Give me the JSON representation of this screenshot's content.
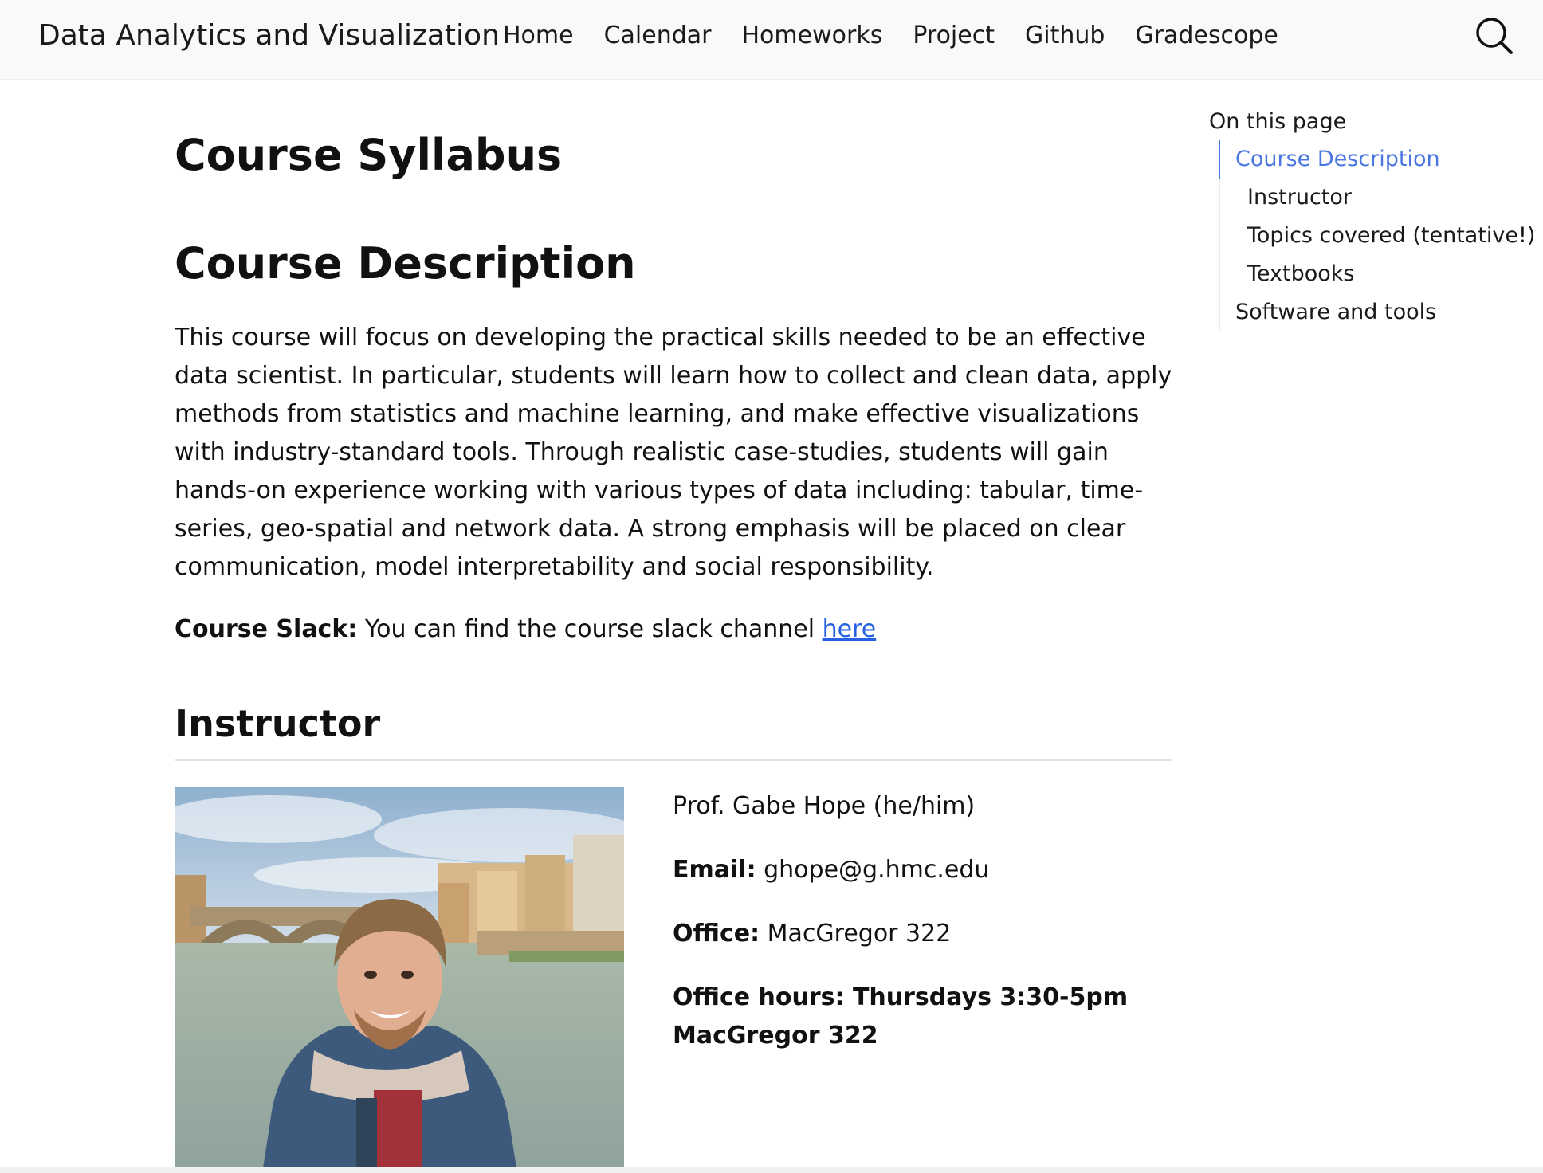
{
  "navbar": {
    "brand": "Data Analytics and Visualization",
    "links": [
      "Home",
      "Calendar",
      "Homeworks",
      "Project",
      "Github",
      "Gradescope"
    ],
    "search_icon": "search-icon"
  },
  "page": {
    "title": "Course Syllabus",
    "course_description": {
      "heading": "Course Description",
      "paragraph": "This course will focus on developing the practical skills needed to be an effective data scientist. In particular, students will learn how to collect and clean data, apply methods from statistics and machine learning, and make effective visualizations with industry-standard tools. Through realistic case-studies, students will gain hands-on experience working with various types of data including: tabular, time-series, geo-spatial and network data. A strong emphasis will be placed on clear communication, model interpretability and social responsibility.",
      "slack_label": "Course Slack:",
      "slack_text": "You can find the course slack channel",
      "slack_link": "here"
    },
    "instructor": {
      "heading": "Instructor",
      "name": "Prof. Gabe Hope (he/him)",
      "email_label": "Email:",
      "email": "ghope@g.hmc.edu",
      "office_label": "Office:",
      "office": "MacGregor 322",
      "hours": "Office hours: Thursdays 3:30-5pm MacGregor 322"
    }
  },
  "toc": {
    "heading": "On this page",
    "items": [
      {
        "label": "Course Description",
        "level": 1,
        "active": true
      },
      {
        "label": "Instructor",
        "level": 2,
        "active": false
      },
      {
        "label": "Topics covered (tentative!)",
        "level": 2,
        "active": false
      },
      {
        "label": "Textbooks",
        "level": 2,
        "active": false
      },
      {
        "label": "Software and tools",
        "level": 1,
        "active": false
      }
    ]
  },
  "colors": {
    "link": "#2761e3",
    "toc_active": "#4a76e0",
    "navbar_bg": "#f8f9fa"
  }
}
